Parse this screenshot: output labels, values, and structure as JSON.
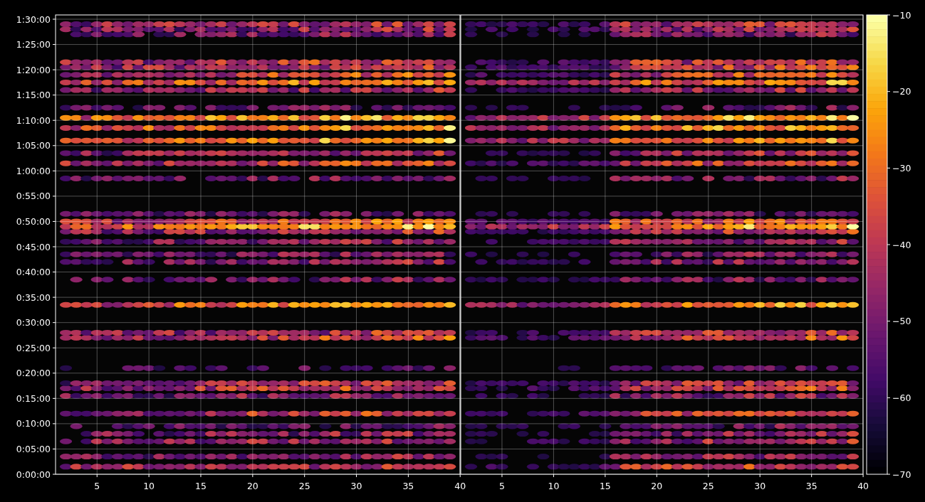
{
  "panels": [
    {
      "xticks": [
        "5",
        "10",
        "15",
        "20",
        "25",
        "30",
        "35",
        "40"
      ]
    },
    {
      "xticks": [
        "5",
        "10",
        "15",
        "20",
        "25",
        "30",
        "35",
        "40"
      ]
    }
  ],
  "yticks": [
    "1:30:00",
    "1:25:00",
    "1:20:00",
    "1:15:00",
    "1:10:00",
    "1:05:00",
    "1:00:00",
    "0:55:00",
    "0:50:00",
    "0:45:00",
    "0:40:00",
    "0:35:00",
    "0:30:00",
    "0:25:00",
    "0:20:00",
    "0:15:00",
    "0:10:00",
    "0:05:00",
    "0:00:00"
  ],
  "colorbar": {
    "ticks": [
      "−10",
      "−20",
      "−30",
      "−40",
      "−50",
      "−60",
      "−70"
    ]
  }
}
